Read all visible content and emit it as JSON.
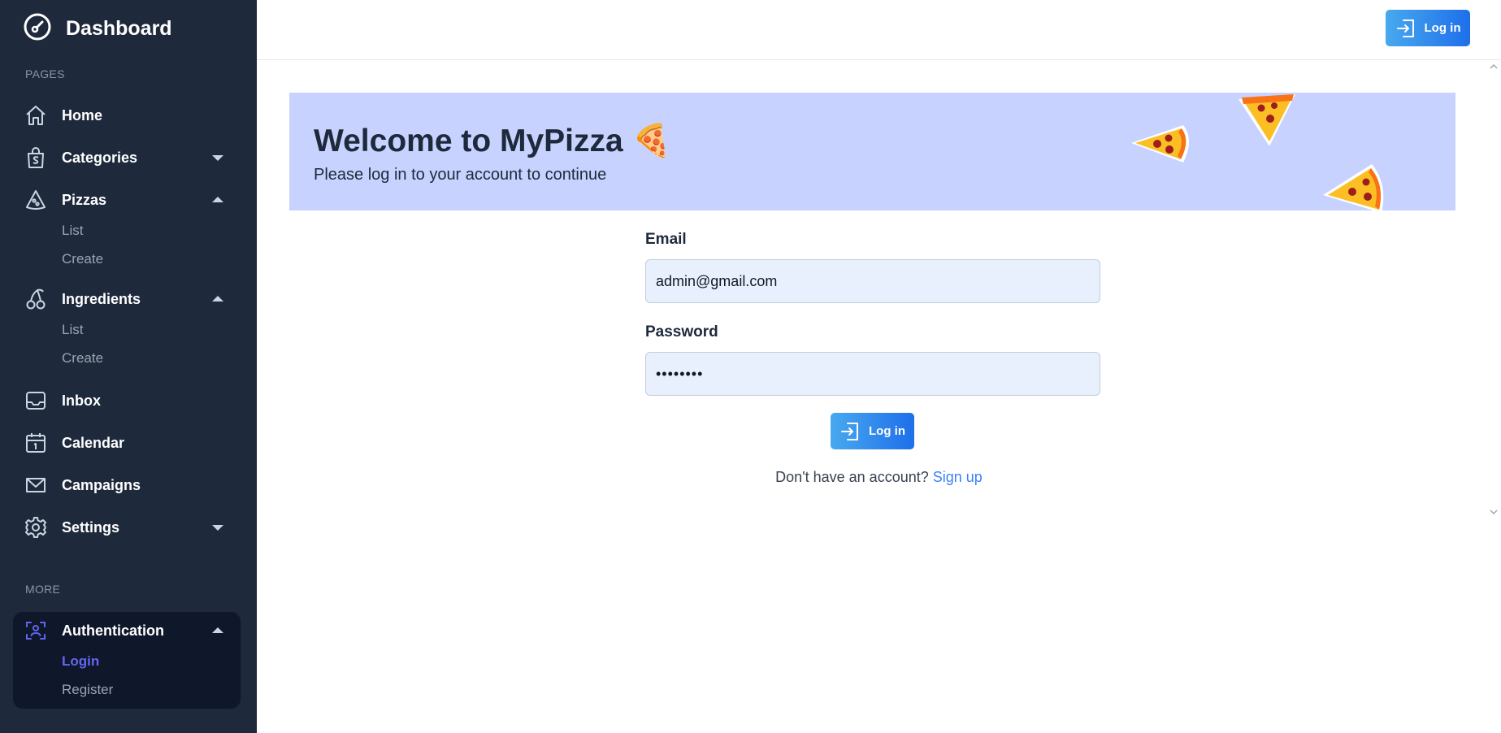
{
  "sidebar": {
    "brand": "Dashboard",
    "sections": {
      "pages": "PAGES",
      "more": "MORE"
    },
    "items": {
      "home": "Home",
      "categories": "Categories",
      "pizzas": "Pizzas",
      "pizzas_list": "List",
      "pizzas_create": "Create",
      "ingredients": "Ingredients",
      "ingredients_list": "List",
      "ingredients_create": "Create",
      "inbox": "Inbox",
      "calendar": "Calendar",
      "campaigns": "Campaigns",
      "settings": "Settings",
      "authentication": "Authentication",
      "login": "Login",
      "register": "Register"
    },
    "icons": {
      "brand": "gauge-icon",
      "home": "home-icon",
      "categories": "shopping-bag-icon",
      "pizzas": "pizza-icon",
      "ingredients": "cherry-icon",
      "inbox": "inbox-icon",
      "calendar": "calendar-icon",
      "campaigns": "envelope-icon",
      "settings": "gear-icon",
      "authentication": "user-scan-icon"
    }
  },
  "header": {
    "login_label": "Log in"
  },
  "banner": {
    "title": "Welcome to MyPizza 🍕",
    "subtitle": "Please log in to your account to continue"
  },
  "form": {
    "email_label": "Email",
    "email_value": "admin@gmail.com",
    "password_label": "Password",
    "password_value": "••••••••",
    "submit_label": "Log in",
    "signup_prompt": "Don't have an account?",
    "signup_link": "Sign up"
  },
  "colors": {
    "sidebar_bg": "#1e293b",
    "active_item": "#6366f1",
    "banner_bg": "#c7d2fe",
    "input_bg": "#e8f0fe",
    "link": "#3b82f6",
    "button_gradient_start": "#48a9ef",
    "button_gradient_end": "#1e6fea"
  }
}
